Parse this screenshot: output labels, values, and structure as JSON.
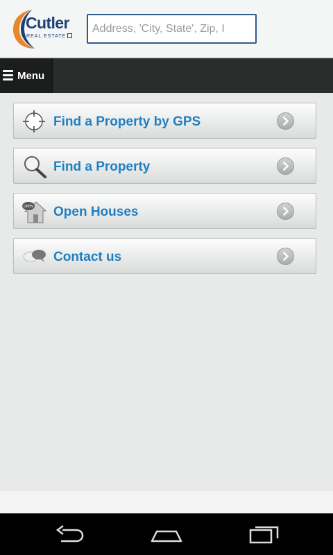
{
  "header": {
    "logo_name": "Cutler",
    "logo_sub": "REAL ESTATE",
    "search_placeholder": "Address, 'City, State', Zip, I"
  },
  "menubar": {
    "menu_label": "Menu"
  },
  "items": [
    {
      "label": "Find a Property by GPS",
      "icon": "crosshair-icon"
    },
    {
      "label": "Find a Property",
      "icon": "magnifier-icon"
    },
    {
      "label": "Open Houses",
      "icon": "open-house-icon"
    },
    {
      "label": "Contact us",
      "icon": "chat-bubbles-icon"
    }
  ],
  "colors": {
    "accent": "#1f7fc1",
    "brand_navy": "#1e3f74",
    "brand_orange": "#e8862a",
    "menubar": "#2b2c2c"
  },
  "system_nav": [
    "back-icon",
    "home-icon",
    "recent-apps-icon"
  ]
}
